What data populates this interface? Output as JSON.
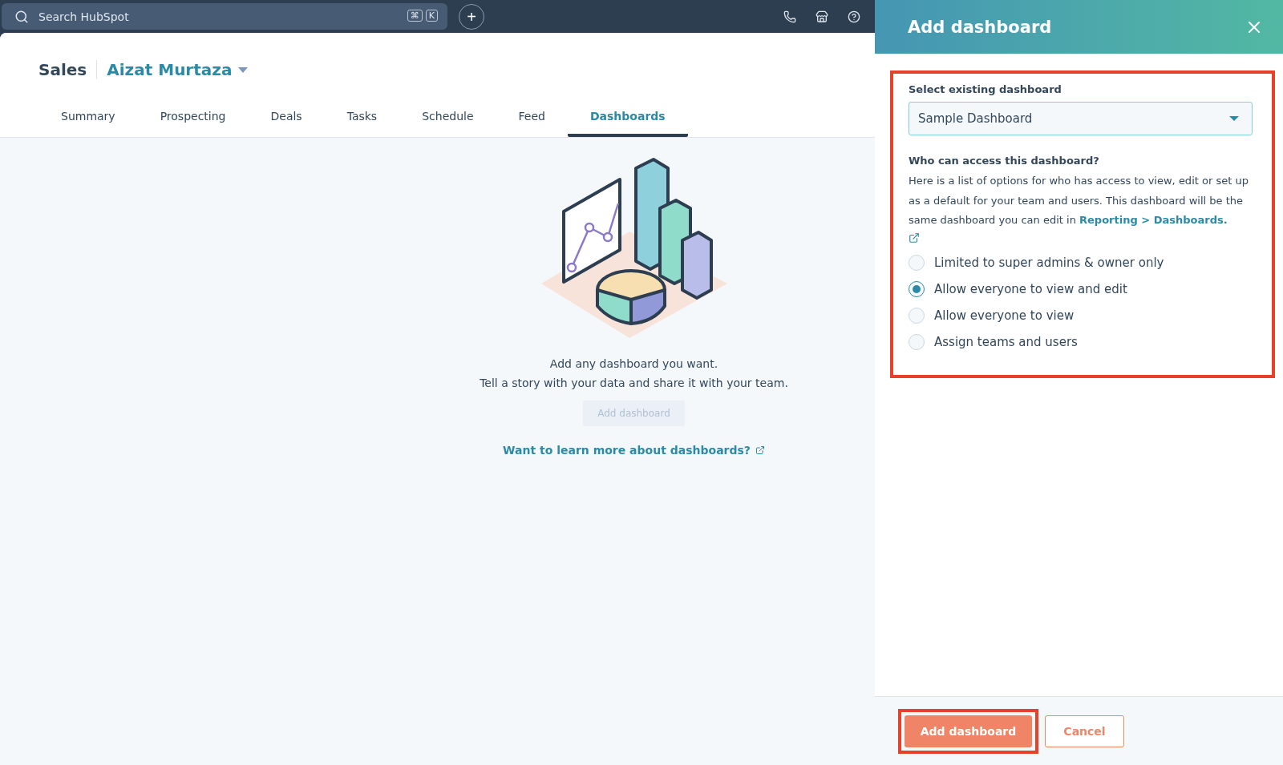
{
  "top_bar": {
    "search": {
      "placeholder": "Search HubSpot",
      "shortcut_keys": [
        "⌘",
        "K"
      ]
    },
    "add_button": "+"
  },
  "header": {
    "title": "Sales",
    "owner": "Aizat Murtaza"
  },
  "tabs": [
    {
      "label": "Summary",
      "selected": false
    },
    {
      "label": "Prospecting",
      "selected": false
    },
    {
      "label": "Deals",
      "selected": false
    },
    {
      "label": "Tasks",
      "selected": false
    },
    {
      "label": "Schedule",
      "selected": false
    },
    {
      "label": "Feed",
      "selected": false
    },
    {
      "label": "Dashboards",
      "selected": true
    }
  ],
  "empty_state": {
    "lines": [
      "Add any dashboard you want.",
      "Tell a story with your data and share it with your team."
    ],
    "button": {
      "label": "Add dashboard",
      "disabled": true
    },
    "link": "Want to learn more about dashboards?"
  },
  "panel": {
    "title": "Add dashboard",
    "select_label": "Select existing dashboard",
    "select_value": "Sample Dashboard",
    "access_heading": "Who can access this dashboard?",
    "description": "Here is a list of options for who has access to view, edit or set up as a default for your team and users. This dashboard will be the same dashboard you can edit in",
    "description_link": "Reporting > Dashboards.",
    "options": [
      {
        "label": "Limited to super admins & owner only",
        "selected": false
      },
      {
        "label": "Allow everyone to view and edit",
        "selected": true
      },
      {
        "label": "Allow everyone to view",
        "selected": false
      },
      {
        "label": "Assign teams and users",
        "selected": false
      }
    ],
    "primary_button": "Add dashboard",
    "secondary_button": "Cancel"
  }
}
